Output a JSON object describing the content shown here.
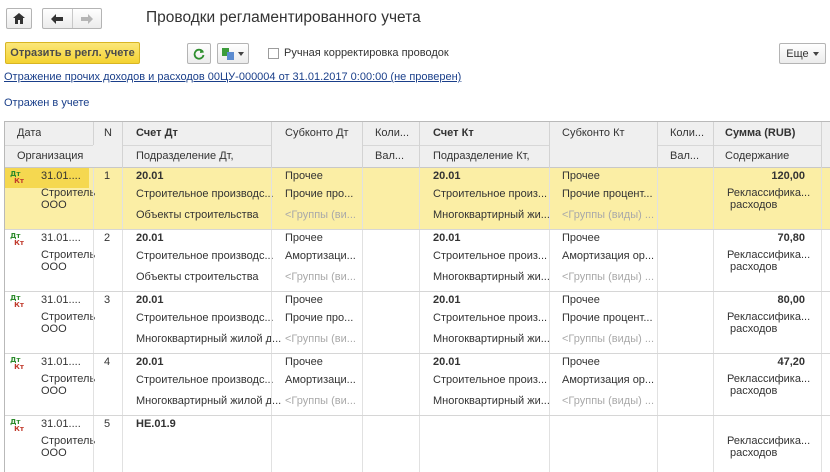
{
  "window": {
    "title": "Проводки регламентированного учета"
  },
  "toolbar": {
    "post_label": "Отразить в регл. учете",
    "manual_label": "Ручная корректировка проводок",
    "more_label": "Еще"
  },
  "document_link": "Отражение прочих доходов и расходов 00ЦУ-000004 от 31.01.2017 0:00:00 (не проверен)",
  "status_link": "Отражен в учете",
  "table": {
    "headers": {
      "date": "Дата",
      "n": "N",
      "acct_dt": "Счет Дт",
      "subkonto_dt": "Субконто Дт",
      "qty_dt": "Коли...",
      "acct_kt": "Счет Кт",
      "subkonto_kt": "Субконто Кт",
      "qty_kt": "Коли...",
      "sum": "Сумма (RUB)",
      "org": "Организация",
      "dept_dt": "Подразделение Дт,",
      "cur_dt": "Вал...",
      "dept_kt": "Подразделение Кт,",
      "cur_kt": "Вал...",
      "content": "Содержание"
    },
    "rows": [
      {
        "date": "31.01....",
        "n": "1",
        "org1": "Строитель",
        "org2": "ООО",
        "acct_dt": "20.01",
        "dept_dt": "Строительное производс...",
        "obj_dt": "Объекты строительства",
        "sub_dt1": "Прочее",
        "sub_dt2": "Прочие про...",
        "sub_dt3": "<Группы (ви...",
        "acct_kt": "20.01",
        "dept_kt": "Строительное произ...",
        "obj_kt": "Многоквартирный жи...",
        "sub_kt1": "Прочее",
        "sub_kt2": "Прочие процент...",
        "sub_kt3": "<Группы (виды) ...",
        "sum": "120,00",
        "content1": "Реклассифика...",
        "content2": "расходов",
        "selected": true
      },
      {
        "date": "31.01....",
        "n": "2",
        "org1": "Строитель",
        "org2": "ООО",
        "acct_dt": "20.01",
        "dept_dt": "Строительное производс...",
        "obj_dt": "Объекты строительства",
        "sub_dt1": "Прочее",
        "sub_dt2": "Амортизаци...",
        "sub_dt3": "<Группы (ви...",
        "acct_kt": "20.01",
        "dept_kt": "Строительное произ...",
        "obj_kt": "Многоквартирный жи...",
        "sub_kt1": "Прочее",
        "sub_kt2": "Амортизация ор...",
        "sub_kt3": "<Группы (виды) ...",
        "sum": "70,80",
        "content1": "Реклассифика...",
        "content2": "расходов",
        "selected": false
      },
      {
        "date": "31.01....",
        "n": "3",
        "org1": "Строитель",
        "org2": "ООО",
        "acct_dt": "20.01",
        "dept_dt": "Строительное производс...",
        "obj_dt": "Многоквартирный жилой д...",
        "sub_dt1": "Прочее",
        "sub_dt2": "Прочие про...",
        "sub_dt3": "<Группы (ви...",
        "acct_kt": "20.01",
        "dept_kt": "Строительное произ...",
        "obj_kt": "Многоквартирный жи...",
        "sub_kt1": "Прочее",
        "sub_kt2": "Прочие процент...",
        "sub_kt3": "<Группы (виды) ...",
        "sum": "80,00",
        "content1": "Реклассифика...",
        "content2": "расходов",
        "selected": false
      },
      {
        "date": "31.01....",
        "n": "4",
        "org1": "Строитель",
        "org2": "ООО",
        "acct_dt": "20.01",
        "dept_dt": "Строительное производс...",
        "obj_dt": "Многоквартирный жилой д...",
        "sub_dt1": "Прочее",
        "sub_dt2": "Амортизаци...",
        "sub_dt3": "<Группы (ви...",
        "acct_kt": "20.01",
        "dept_kt": "Строительное произ...",
        "obj_kt": "Многоквартирный жи...",
        "sub_kt1": "Прочее",
        "sub_kt2": "Амортизация ор...",
        "sub_kt3": "<Группы (виды) ...",
        "sum": "47,20",
        "content1": "Реклассифика...",
        "content2": "расходов",
        "selected": false
      },
      {
        "date": "31.01....",
        "n": "5",
        "org1": "Строитель",
        "org2": "ООО",
        "acct_dt": "НЕ.01.9",
        "dept_dt": "",
        "obj_dt": "",
        "sub_dt1": "",
        "sub_dt2": "",
        "sub_dt3": "",
        "acct_kt": "",
        "dept_kt": "",
        "obj_kt": "",
        "sub_kt1": "",
        "sub_kt2": "",
        "sub_kt3": "",
        "sum": "",
        "content1": "Реклассифика...",
        "content2": "расходов",
        "selected": false
      }
    ]
  }
}
